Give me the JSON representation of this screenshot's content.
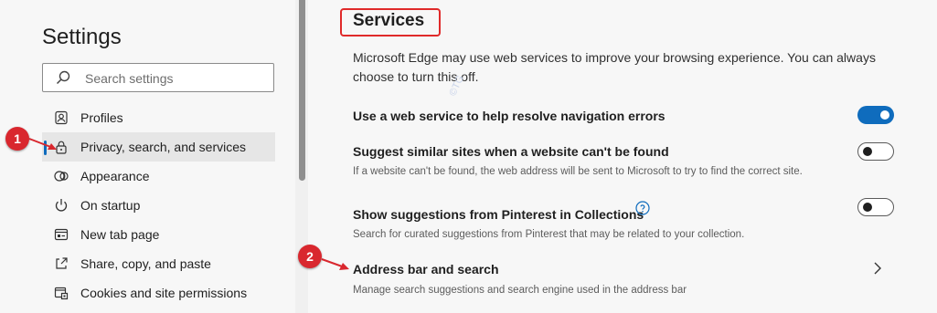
{
  "sidebar": {
    "title": "Settings",
    "search_placeholder": "Search settings",
    "items": [
      {
        "label": "Profiles",
        "icon": "profile-icon"
      },
      {
        "label": "Privacy, search, and services",
        "icon": "lock-icon",
        "active": true
      },
      {
        "label": "Appearance",
        "icon": "appearance-icon"
      },
      {
        "label": "On startup",
        "icon": "power-icon"
      },
      {
        "label": "New tab page",
        "icon": "new-tab-icon"
      },
      {
        "label": "Share, copy, and paste",
        "icon": "share-icon"
      },
      {
        "label": "Cookies and site permissions",
        "icon": "cookies-icon"
      }
    ]
  },
  "annotations": {
    "one": "1",
    "two": "2",
    "color": "#d9272e"
  },
  "watermark": "©TG",
  "services": {
    "title": "Services",
    "intro": "Microsoft Edge may use web services to improve your browsing experience. You can always choose to turn this off.",
    "rows": [
      {
        "label": "Use a web service to help resolve navigation errors",
        "desc": "",
        "toggle": "on"
      },
      {
        "label": "Suggest similar sites when a website can't be found",
        "desc": "If a website can't be found, the web address will be sent to Microsoft to try to find the correct site.",
        "toggle": "off"
      },
      {
        "label": "Show suggestions from Pinterest in Collections",
        "desc": "Search for curated suggestions from Pinterest that may be related to your collection.",
        "toggle": "off",
        "help_icon": "help-icon"
      },
      {
        "label": "Address bar and search",
        "desc": "Manage search suggestions and search engine used in the address bar",
        "chevron": "chevron-right-icon"
      }
    ]
  },
  "colors": {
    "accent": "#0f6cbd",
    "highlight": "#e02a2a"
  }
}
